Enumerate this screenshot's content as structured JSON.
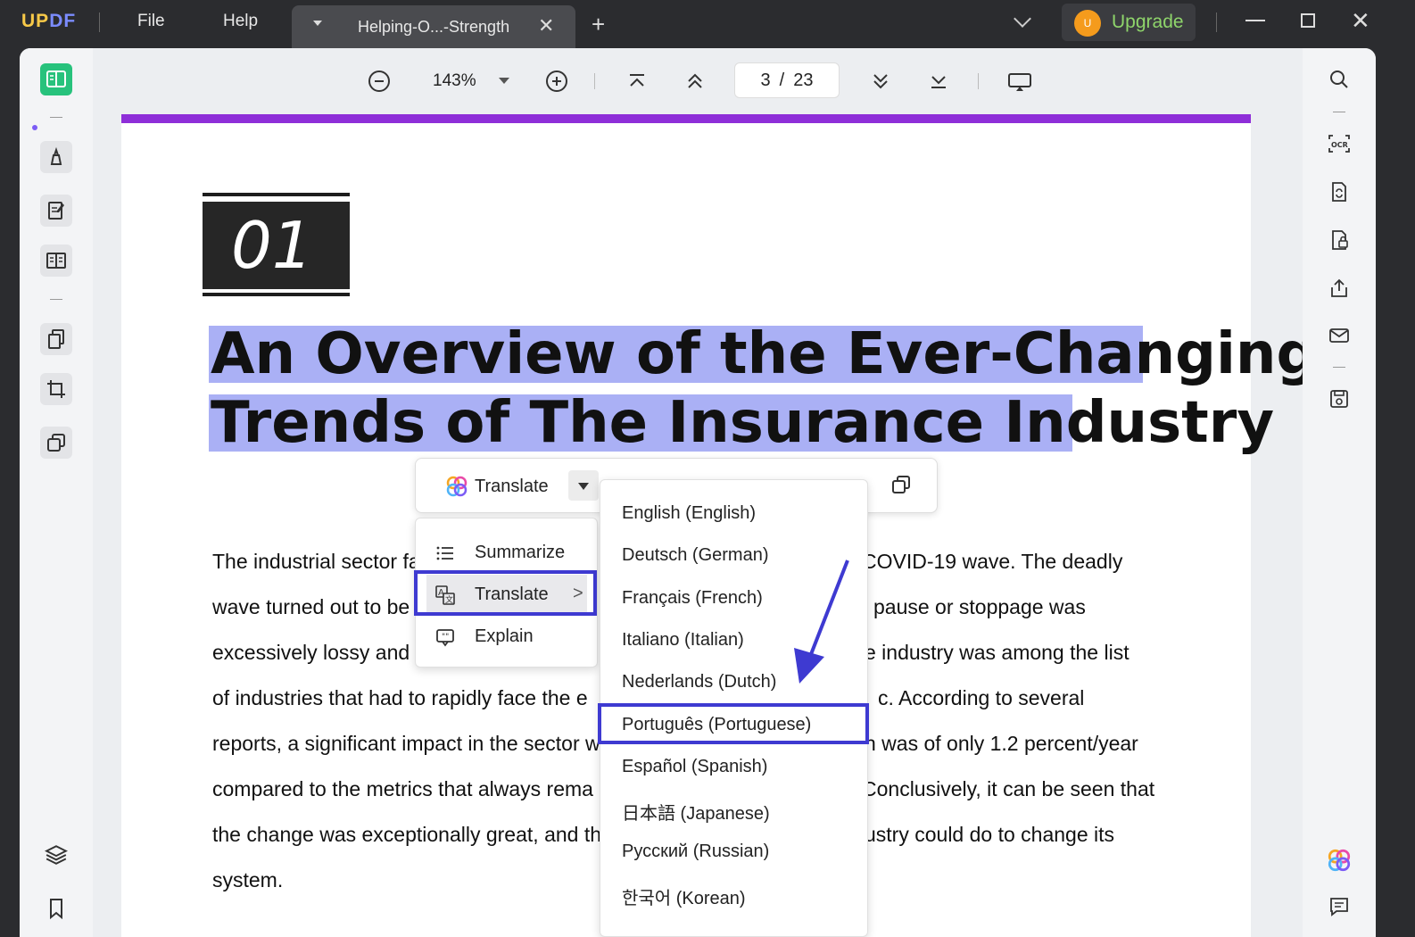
{
  "titlebar": {
    "logo_up": "UP",
    "logo_df": "DF",
    "menu_file": "File",
    "menu_help": "Help",
    "tab_title": "Helping-O...-Strength",
    "avatar_initial": "U",
    "upgrade_label": "Upgrade",
    "brand_color": "#8e2ed8",
    "upgrade_color": "#8fd56b"
  },
  "toolbar": {
    "zoom": "143%",
    "current_page": "3",
    "page_sep": "/",
    "total_pages": "23"
  },
  "document": {
    "number": "01",
    "heading_line1": "An Overview of the Ever-Changing",
    "heading_line2": "Trends of The Insurance Industry",
    "body_lines": [
      {
        "left": "The industrial sector fa",
        "right": "COVID-19 wave. The deadly"
      },
      {
        "left": "wave turned out to be",
        "right": "pause or stoppage was"
      },
      {
        "left": "excessively lossy and i",
        "right": "e industry was among the list"
      },
      {
        "left": "of industries that had to rapidly face the e",
        "right": "c. According to several"
      },
      {
        "left": "reports, a significant impact in the sector w",
        "right": "h was of only 1.2 percent/year"
      },
      {
        "left": "compared to the metrics that always rema",
        "right": "Conclusively, it can be seen that"
      },
      {
        "left": "the change was exceptionally great, and th",
        "right": "ustry could do to change its"
      },
      {
        "left": "system.",
        "right": ""
      }
    ]
  },
  "float_toolbar": {
    "translate_label": "Translate"
  },
  "ai_menu": {
    "items": [
      {
        "label": "Summarize",
        "icon": "list-icon"
      },
      {
        "label": "Translate",
        "icon": "translate-icon",
        "arrow": ">"
      },
      {
        "label": "Explain",
        "icon": "explain-icon"
      }
    ]
  },
  "lang_menu": {
    "items": [
      "English (English)",
      "Deutsch (German)",
      "Français (French)",
      "Italiano (Italian)",
      "Nederlands (Dutch)",
      "Português (Portuguese)",
      "Español (Spanish)",
      "日本語 (Japanese)",
      "Русский (Russian)",
      "한국어 (Korean)"
    ],
    "selected": "Português (Portuguese)",
    "highlight_color": "#3e3ad1"
  }
}
